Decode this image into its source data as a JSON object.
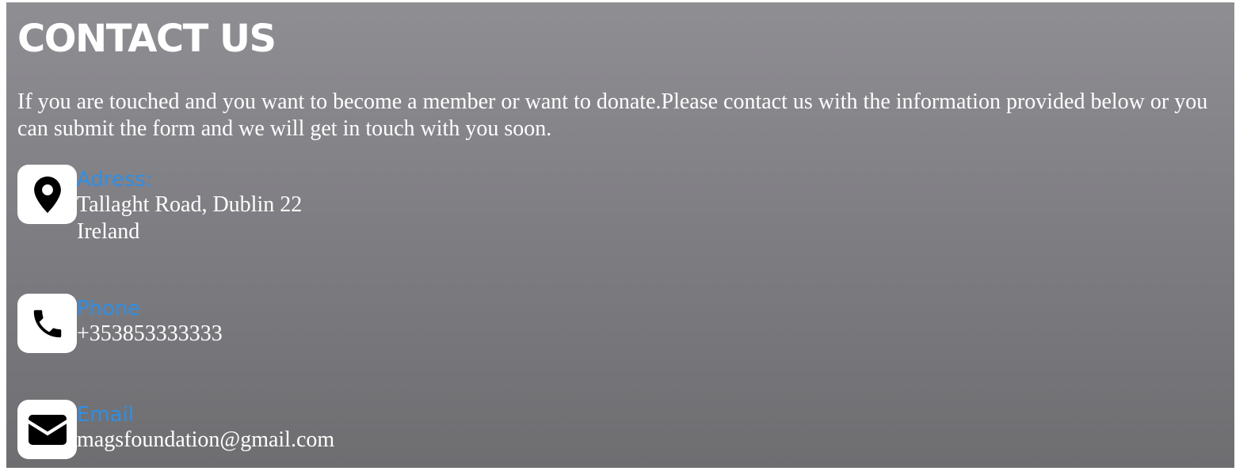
{
  "contact": {
    "title": "CONTACT US",
    "intro": "If you are touched and you want to become a member or want to donate.Please contact us with the information provided below or you can submit the form and we will get in touch with you soon.",
    "address": {
      "icon": "location-pin-icon",
      "label": "Adress:",
      "line1": "Tallaght Road, Dublin 22",
      "line2": "Ireland"
    },
    "phone": {
      "icon": "phone-icon",
      "label": "Phone",
      "value": "+353853333333"
    },
    "email": {
      "icon": "envelope-icon",
      "label": "Email",
      "value": "magsfoundation@gmail.com"
    }
  },
  "colors": {
    "label_accent": "#2f8fe6",
    "text": "#ffffff",
    "icon_box": "#ffffff",
    "icon": "#000000"
  }
}
